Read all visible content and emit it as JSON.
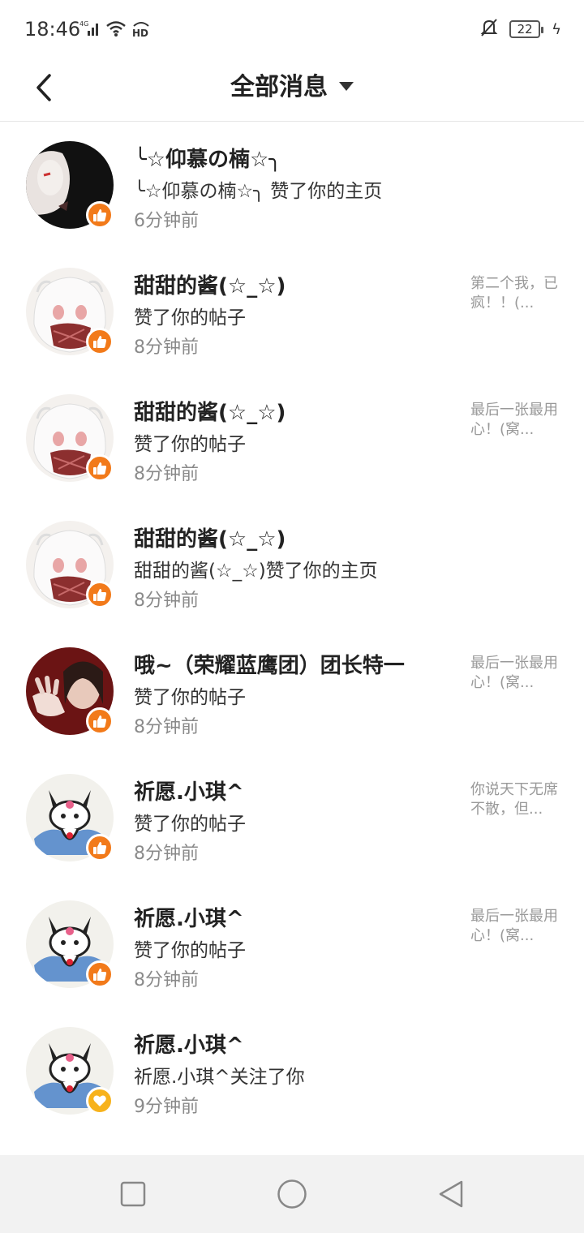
{
  "status_bar": {
    "time": "18:46",
    "network": "4G",
    "hd": "HD",
    "battery": "22"
  },
  "header": {
    "title": "全部消息"
  },
  "messages": [
    {
      "name": "╰☆仰慕の楠☆╮",
      "desc": "╰☆仰慕の楠☆╮ 赞了你的主页",
      "time": "6分钟前",
      "preview": "",
      "badge": "like",
      "avatar_style": "dark-mask"
    },
    {
      "name": "甜甜的酱(☆_☆)",
      "desc": "赞了你的帖子",
      "time": "8分钟前",
      "preview": "第二个我，已疯！！(...",
      "badge": "like",
      "avatar_style": "anime-girl"
    },
    {
      "name": "甜甜的酱(☆_☆)",
      "desc": "赞了你的帖子",
      "time": "8分钟前",
      "preview": "最后一张最用心！(窝...",
      "badge": "like",
      "avatar_style": "anime-girl"
    },
    {
      "name": "甜甜的酱(☆_☆)",
      "desc": "甜甜的酱(☆_☆)赞了你的主页",
      "time": "8分钟前",
      "preview": "",
      "badge": "like",
      "avatar_style": "anime-girl"
    },
    {
      "name": "哦~（荣耀蓝鹰团）团长特一",
      "desc": "赞了你的帖子",
      "time": "8分钟前",
      "preview": "最后一张最用心！(窝...",
      "badge": "like",
      "avatar_style": "photo-red"
    },
    {
      "name": "祈愿.小琪^",
      "desc": "赞了你的帖子",
      "time": "8分钟前",
      "preview": "你说天下无席不散，但...",
      "badge": "like",
      "avatar_style": "kuromi"
    },
    {
      "name": "祈愿.小琪^",
      "desc": "赞了你的帖子",
      "time": "8分钟前",
      "preview": "最后一张最用心！(窝...",
      "badge": "like",
      "avatar_style": "kuromi"
    },
    {
      "name": "祈愿.小琪^",
      "desc": "祈愿.小琪^关注了你",
      "time": "9分钟前",
      "preview": "",
      "badge": "follow",
      "avatar_style": "kuromi"
    }
  ],
  "colors": {
    "like_badge": "#f27a1a",
    "follow_badge": "#f7b21c",
    "time_text": "#8a8a8a",
    "preview_text": "#999999"
  },
  "icons": {
    "back": "chevron-left-icon",
    "dropdown": "caret-down-icon",
    "like": "thumbs-up-icon",
    "follow": "heart-icon",
    "nav_recent": "square-icon",
    "nav_home": "circle-icon",
    "nav_back": "triangle-back-icon"
  }
}
